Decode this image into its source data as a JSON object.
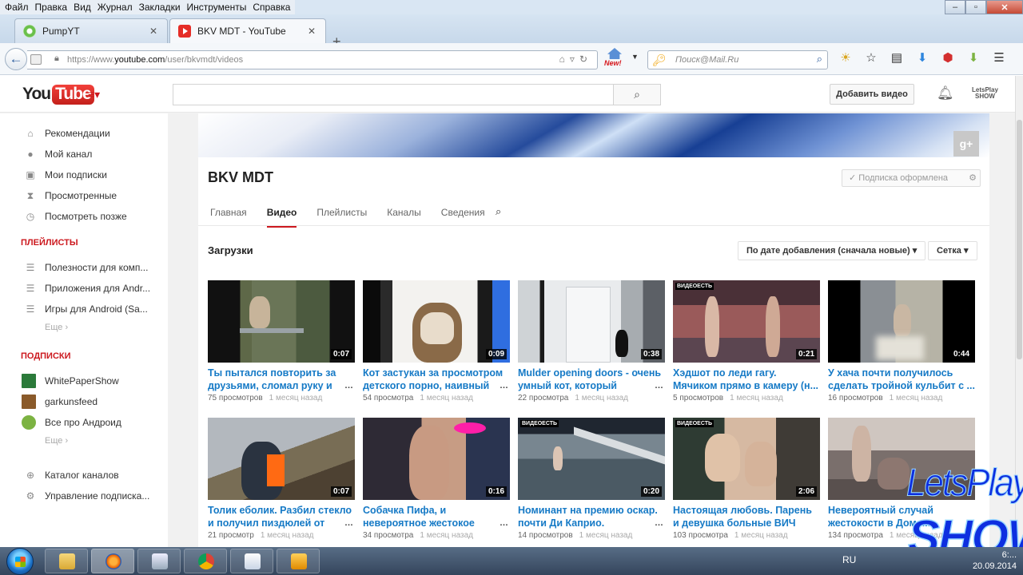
{
  "browser": {
    "menu": [
      "Файл",
      "Правка",
      "Вид",
      "Журнал",
      "Закладки",
      "Инструменты",
      "Справка"
    ],
    "tabs": [
      {
        "label": "PumpYT"
      },
      {
        "label": "BKV MDT - YouTube"
      }
    ],
    "url_prefix": "https://www.",
    "url_host": "youtube.com",
    "url_path": "/user/bkvmdt/videos",
    "new_badge": "New!",
    "search_placeholder": "Поиск@Mail.Ru"
  },
  "youtube": {
    "logo_you": "You",
    "logo_tube": "Tube",
    "upload_label": "Добавить видео",
    "show_badge_top": "LetsPlay",
    "show_badge_bottom": "SHOW"
  },
  "sidebar": {
    "items": [
      {
        "label": "Рекомендации",
        "icon": "home-icon"
      },
      {
        "label": "Мой канал",
        "icon": "user-icon"
      },
      {
        "label": "Мои подписки",
        "icon": "subscriptions-icon"
      },
      {
        "label": "Просмотренные",
        "icon": "history-icon"
      },
      {
        "label": "Посмотреть позже",
        "icon": "clock-icon"
      }
    ],
    "playlists_header": "ПЛЕЙЛИСТЫ",
    "playlists": [
      {
        "label": "Полезности для комп..."
      },
      {
        "label": "Приложения для Andr..."
      },
      {
        "label": "Игры для Android (Sa..."
      }
    ],
    "more_label": "Еще ›",
    "subscriptions_header": "ПОДПИСКИ",
    "subscriptions": [
      {
        "label": "WhitePaperShow",
        "color": "#2b7a3a"
      },
      {
        "label": "garkunsfeed",
        "color": "#8a5a2a"
      },
      {
        "label": "Все про Андроид",
        "color": "#7cb342"
      }
    ],
    "more2_label": "Еще ›",
    "bottom": [
      {
        "label": "Каталог каналов",
        "icon": "plus-circle-icon"
      },
      {
        "label": "Управление подписка...",
        "icon": "gear-icon"
      }
    ]
  },
  "channel": {
    "title": "BKV MDT",
    "subscribed_label": "Подписка оформлена",
    "tabs": [
      "Главная",
      "Видео",
      "Плейлисты",
      "Каналы",
      "Сведения"
    ],
    "active_tab": "Видео",
    "uploads_header": "Загрузки",
    "sort_label": "По дате добавления (сначала новые)",
    "view_label": "Сетка",
    "videos": [
      {
        "title": "Ты пытался повторить за друзьями, сломал руку и",
        "duration": "0:07",
        "views": "75 просмотров",
        "ago": "1 месяц назад"
      },
      {
        "title": "Кот застукан за просмотром детского порно, наивный",
        "duration": "0:09",
        "views": "54 просмотра",
        "ago": "1 месяц назад"
      },
      {
        "title": "Mulder opening doors - очень умный кот, который",
        "duration": "0:38",
        "views": "22 просмотра",
        "ago": "1 месяц назад"
      },
      {
        "title": "Хэдшот по леди гагу. Мячиком прямо в камеру (н...",
        "duration": "0:21",
        "views": "5 просмотров",
        "ago": "1 месяц назад"
      },
      {
        "title": "У хача почти получилось сделать тройной кульбит с ...",
        "duration": "0:44",
        "views": "16 просмотров",
        "ago": "1 месяц назад"
      },
      {
        "title": "Толик еболик. Разбил стекло и получил пиздюлей от",
        "duration": "0:07",
        "views": "21 просмотр",
        "ago": "1 месяц назад"
      },
      {
        "title": "Собачка Пифа, и невероятное жестокое",
        "duration": "0:16",
        "views": "34 просмотра",
        "ago": "1 месяц назад"
      },
      {
        "title": "Номинант на премию оскар. почти Ди Каприо.",
        "duration": "0:20",
        "views": "14 просмотров",
        "ago": "1 месяц назад"
      },
      {
        "title": "Настоящая любовь. Парень и девушка больные ВИЧ любо...",
        "duration": "2:06",
        "views": "103 просмотра",
        "ago": "1 месяц назад"
      },
      {
        "title": "Невероятный случай жестокости в Доме...",
        "duration": "",
        "views": "134 просмотра",
        "ago": "1 месяц назад"
      }
    ],
    "thumb_overlay": "ВИДЕОЕСТЬ"
  },
  "watermark": {
    "line1": "LetsPlay",
    "line2": "SHOW"
  },
  "taskbar": {
    "lang": "RU",
    "time": "6:...",
    "date": "20.09.2014"
  }
}
